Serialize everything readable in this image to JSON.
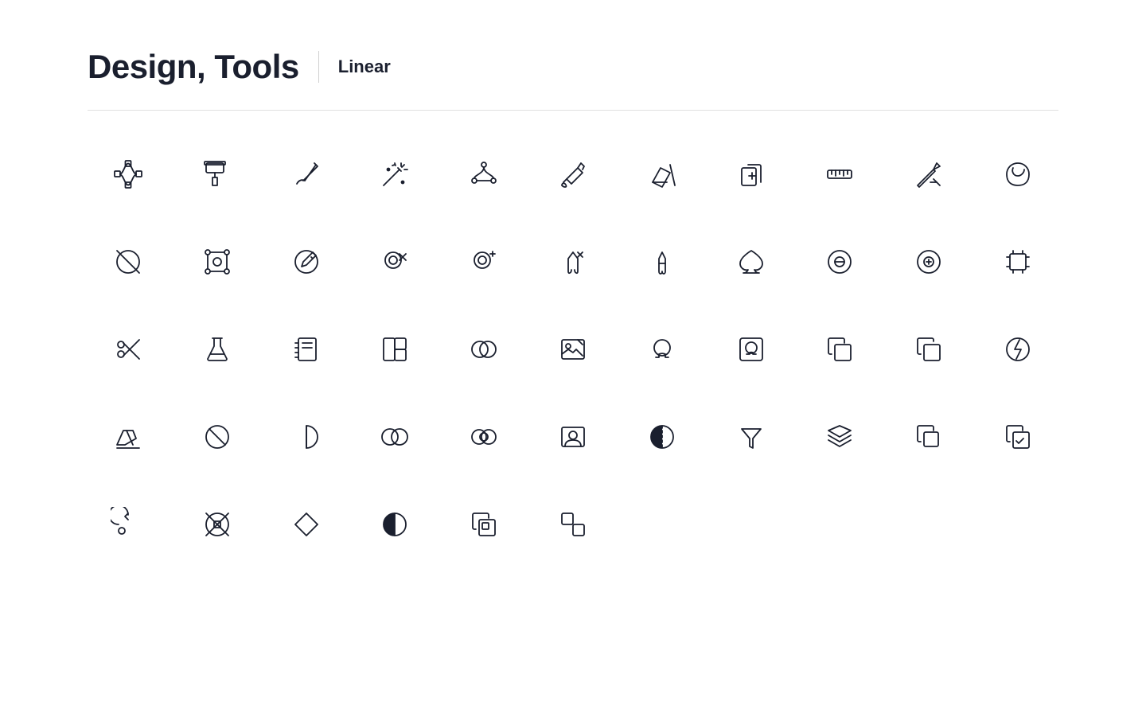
{
  "header": {
    "title": "Design, Tools",
    "subtitle": "Linear"
  },
  "icons": [
    {
      "name": "bezier-tool-icon"
    },
    {
      "name": "paint-roller-icon"
    },
    {
      "name": "brush-icon"
    },
    {
      "name": "magic-wand-icon"
    },
    {
      "name": "node-editor-icon"
    },
    {
      "name": "fill-bucket-icon"
    },
    {
      "name": "eraser-fill-icon"
    },
    {
      "name": "copy-add-icon"
    },
    {
      "name": "ruler-icon"
    },
    {
      "name": "tools-cross-icon"
    },
    {
      "name": "blob-shape-icon"
    },
    {
      "name": "help-circle-icon"
    },
    {
      "name": "transform-icon"
    },
    {
      "name": "edit-circle-icon"
    },
    {
      "name": "stamp-remove-icon"
    },
    {
      "name": "stamp-add-icon"
    },
    {
      "name": "dropper-remove-icon"
    },
    {
      "name": "dropper-icon"
    },
    {
      "name": "spade-icon"
    },
    {
      "name": "stamp-circle-minus-icon"
    },
    {
      "name": "stamp-circle-plus-icon"
    },
    {
      "name": "frame-tool-icon"
    },
    {
      "name": "scissors-icon"
    },
    {
      "name": "flask-icon"
    },
    {
      "name": "notebook-icon"
    },
    {
      "name": "palette-swatch-icon"
    },
    {
      "name": "intersect-circle-icon"
    },
    {
      "name": "photo-edit-icon"
    },
    {
      "name": "omega-icon"
    },
    {
      "name": "omega-square-icon"
    },
    {
      "name": "copy-icon"
    },
    {
      "name": "copy-2-icon"
    },
    {
      "name": "flash-circle-icon"
    },
    {
      "name": "eraser-icon"
    },
    {
      "name": "ban-icon"
    },
    {
      "name": "half-circle-icon"
    },
    {
      "name": "blend-icon"
    },
    {
      "name": "blend-2-icon"
    },
    {
      "name": "photo-id-icon"
    },
    {
      "name": "contrast-icon"
    },
    {
      "name": "filter-icon"
    },
    {
      "name": "layers-icon"
    },
    {
      "name": "duplicate-icon"
    },
    {
      "name": "copy-check-icon"
    },
    {
      "name": "rotate-icon"
    },
    {
      "name": "bandaid-icon"
    },
    {
      "name": "diamond-icon"
    },
    {
      "name": "half-fill-circle-icon"
    },
    {
      "name": "copy-3-icon"
    },
    {
      "name": "ungroup-icon"
    }
  ]
}
